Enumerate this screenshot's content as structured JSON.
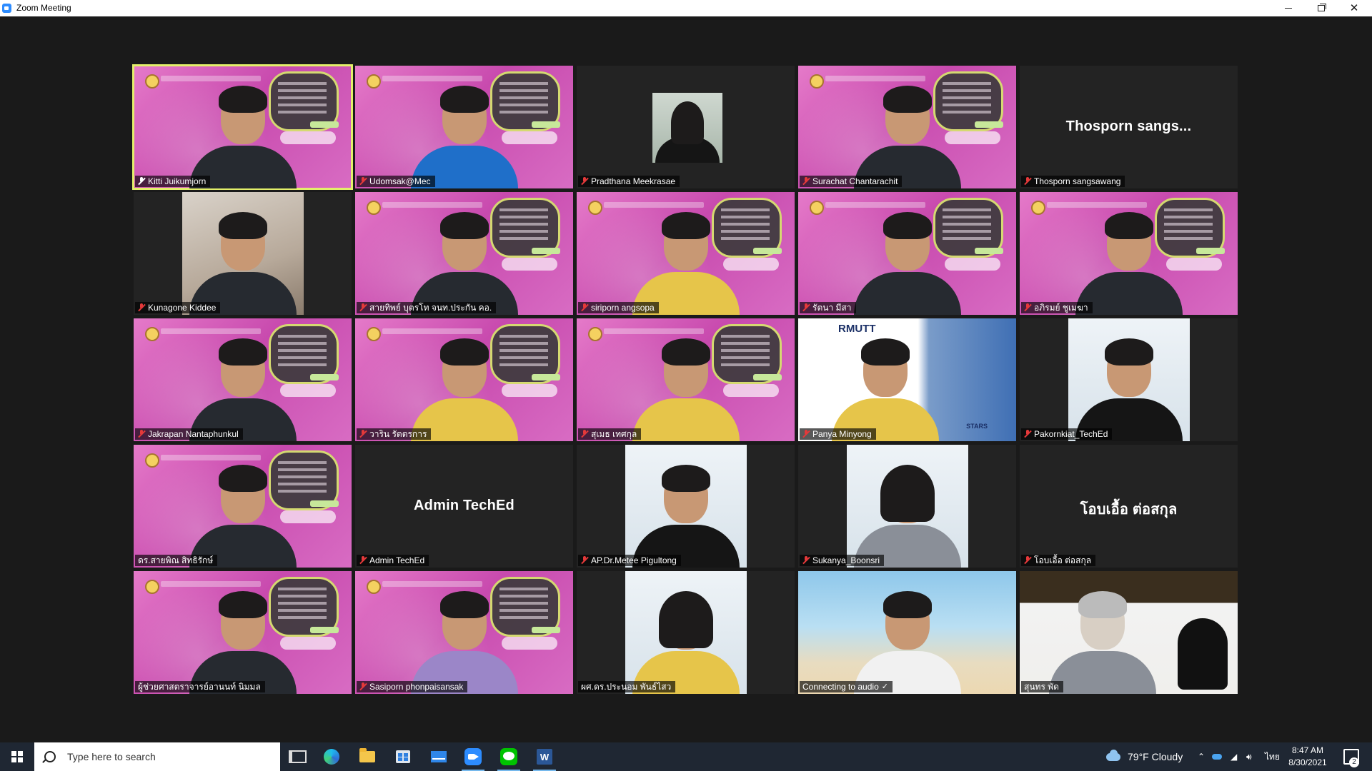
{
  "window": {
    "title": "Zoom Meeting",
    "minimize_label": "",
    "maximize_label": "",
    "close_label": "✕"
  },
  "gallery": {
    "tiles": [
      {
        "name": "Kitti Juikumjorn",
        "mic": "active",
        "style": "pink",
        "active_speaker": true
      },
      {
        "name": "Udomsak@Mec",
        "mic": "muted",
        "style": "pink"
      },
      {
        "name": "Pradthana Meekrasae",
        "mic": "muted",
        "style": "photo-small"
      },
      {
        "name": "Surachat Chantarachit",
        "mic": "muted",
        "style": "pink"
      },
      {
        "name": "Thosporn sangsawang",
        "mic": "muted",
        "style": "dark",
        "display_name": "Thosporn sangs..."
      },
      {
        "name": "Kunagone Kiddee",
        "mic": "muted",
        "style": "photo"
      },
      {
        "name": "สายทิพย์  บุตรโท จนท.ประกัน คอ.",
        "mic": "muted",
        "style": "pink"
      },
      {
        "name": "siriporn angsopa",
        "mic": "muted",
        "style": "pink"
      },
      {
        "name": "รัตนา  มีสา",
        "mic": "muted",
        "style": "pink"
      },
      {
        "name": "อภิรมย์ ชูเมฆา",
        "mic": "muted",
        "style": "pink"
      },
      {
        "name": "Jakrapan Nantaphunkul",
        "mic": "muted",
        "style": "pink"
      },
      {
        "name": "วาริน  รัตตรการ",
        "mic": "muted",
        "style": "pink"
      },
      {
        "name": "สุเมธ เทศกุล",
        "mic": "muted",
        "style": "pink"
      },
      {
        "name": "Panya Minyong",
        "mic": "muted",
        "style": "rmutt"
      },
      {
        "name": "Pakornkiat_TechEd",
        "mic": "muted",
        "style": "portrait"
      },
      {
        "name": "ดร.สายพิณ  สิทธิรักษ์",
        "mic": "none",
        "style": "pink"
      },
      {
        "name": "Admin TechEd",
        "mic": "muted",
        "style": "dark",
        "display_name": "Admin TechEd"
      },
      {
        "name": "AP.Dr.Metee Pigultong",
        "mic": "muted",
        "style": "portrait"
      },
      {
        "name": "Sukanya_Boonsri",
        "mic": "muted",
        "style": "portrait"
      },
      {
        "name": "โอบเอื้อ ต่อสกุล",
        "mic": "muted",
        "style": "dark",
        "display_name": "โอบเอื้อ ต่อสกุล"
      },
      {
        "name": "ผู้ช่วยศาสตราจารย์อานนท์ นิมมล",
        "mic": "none",
        "style": "pink"
      },
      {
        "name": "Sasiporn phonpaisansak",
        "mic": "muted",
        "style": "pink"
      },
      {
        "name": "ผศ.ดร.ประนอม พันธ์ไสว",
        "mic": "none",
        "style": "portrait"
      },
      {
        "name": "Connecting to audio",
        "mic": "none",
        "style": "beach",
        "check": true
      },
      {
        "name": "สุนทร พัด",
        "mic": "none",
        "style": "slide"
      }
    ],
    "overlay_text": {
      "rmutt_logo": "RMUTT",
      "stars": "STARS"
    }
  },
  "taskbar": {
    "search_placeholder": "Type here to search",
    "weather": "79°F  Cloudy",
    "language": "ไทย",
    "time": "8:47 AM",
    "date": "8/30/2021",
    "notifications": "2",
    "apps": [
      "task-view",
      "edge",
      "file-explorer",
      "store",
      "mail",
      "zoom",
      "line",
      "word"
    ]
  },
  "colors": {
    "meeting_bg": "#1a1a1a",
    "active_speaker_border": "#e3f06a",
    "muted_mic": "#e4393a",
    "taskbar_bg": "#1f2733"
  }
}
